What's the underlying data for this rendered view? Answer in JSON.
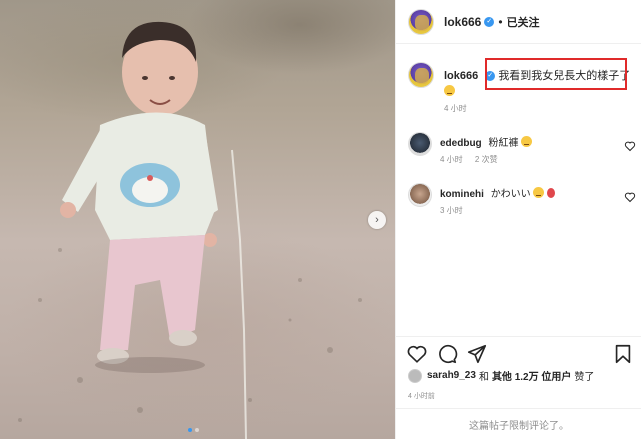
{
  "post": {
    "username": "lok666",
    "separator": "•",
    "follow_label": "已关注",
    "caption": {
      "username": "lok666",
      "text": "我看到我女兒長大的樣子了",
      "time": "4 小时"
    },
    "comments": [
      {
        "username": "ededbug",
        "text": "粉紅褲",
        "time": "4 小时",
        "likes": "2 次赞"
      },
      {
        "username": "kominehi",
        "text": "かわいい",
        "time": "3 小时"
      }
    ],
    "likes": {
      "user": "sarah9_23",
      "and": "和",
      "others": "其他 1.2万 位用户",
      "suffix": "赞了"
    },
    "timestamp": "4 小时前",
    "comments_disabled": "这篇帖子限制评论了。",
    "carousel_next_icon": "chevron-right-icon"
  },
  "colors": {
    "verified": "#3897f0",
    "highlight_box": "#e02a2a"
  }
}
